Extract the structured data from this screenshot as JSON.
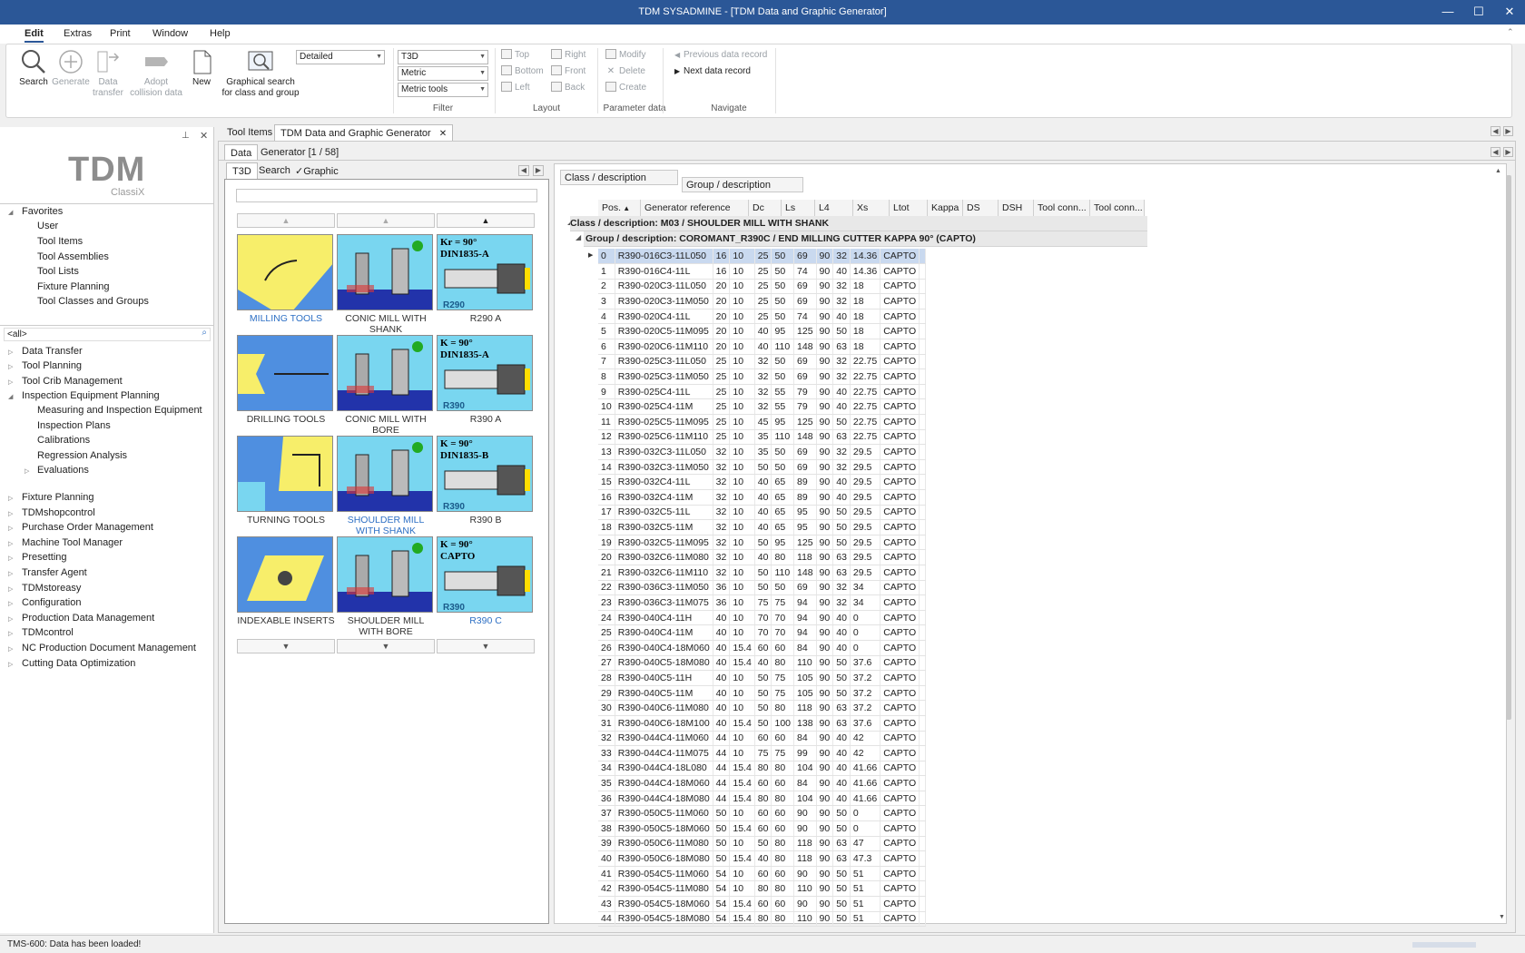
{
  "window": {
    "title": "TDM SYSADMINE - [TDM Data and Graphic Generator]",
    "minimize": "—",
    "maximize": "☐",
    "close": "✕"
  },
  "menu": {
    "items": [
      "Edit",
      "Extras",
      "Print",
      "Window",
      "Help"
    ]
  },
  "ribbon": {
    "search": "Search",
    "generate": "Generate",
    "data_transfer_1": "Data",
    "data_transfer_2": "transfer",
    "adopt_1": "Adopt",
    "adopt_2": "collision data",
    "new": "New",
    "graph_search_1": "Graphical search",
    "graph_search_2": "for class and group",
    "filter": {
      "combo_view": "Detailed",
      "combo_type": "T3D",
      "combo_unit": "Metric",
      "combo_tools": "Metric tools",
      "label": "Filter"
    },
    "layout": {
      "top": "Top",
      "right": "Right",
      "bottom": "Bottom",
      "front": "Front",
      "left": "Left",
      "back": "Back",
      "label": "Layout"
    },
    "parameter": {
      "modify": "Modify",
      "delete": "Delete",
      "create": "Create",
      "label": "Parameter data"
    },
    "navigate": {
      "prev": "Previous data record",
      "next": "Next data record",
      "label": "Navigate"
    }
  },
  "left_panel": {
    "logo_main": "TDM",
    "logo_sub": "ClassiX",
    "favorites_label": "Favorites",
    "favorites": [
      "User",
      "Tool Items",
      "Tool Assemblies",
      "Tool Lists",
      "Fixture Planning",
      "Tool Classes and Groups"
    ],
    "filter_value": "<all>",
    "modules": [
      "Data Transfer",
      "Tool Planning",
      "Tool Crib Management",
      "Inspection Equipment Planning"
    ],
    "inspection_children": [
      "Measuring and Inspection Equipment",
      "Inspection Plans",
      "Calibrations",
      "Regression Analysis",
      "Evaluations"
    ],
    "modules_after": [
      "Fixture Planning",
      "TDMshopcontrol",
      "Purchase Order Management",
      "Machine Tool Manager",
      "Presetting",
      "Transfer Agent",
      "TDMstoreasy",
      "Configuration",
      "Production Data Management",
      "TDMcontrol",
      "NC Production Document Management",
      "Cutting Data Optimization"
    ]
  },
  "tabs": {
    "tool_items": "Tool Items",
    "generator": "TDM Data and Graphic Generator",
    "close": "✕"
  },
  "subtabs": {
    "data": "Data",
    "generator": "Generator [1 / 58]"
  },
  "gallery_tabs": {
    "t3d": "T3D",
    "search": "Search",
    "graphic": "Graphic"
  },
  "gallery": {
    "tiles": [
      {
        "caption": "MILLING TOOLS",
        "link": true
      },
      {
        "caption": "CONIC MILL WITH SHANK",
        "link": false
      },
      {
        "caption": "R290 A",
        "link": false,
        "badge": "Kr = 90°",
        "std": "DIN1835-A",
        "code": "R290"
      },
      {
        "caption": "DRILLING TOOLS",
        "link": false
      },
      {
        "caption": "CONIC MILL WITH BORE",
        "link": false
      },
      {
        "caption": "R390 A",
        "link": false,
        "badge": "K = 90°",
        "std": "DIN1835-A",
        "code": "R390"
      },
      {
        "caption": "TURNING TOOLS",
        "link": false
      },
      {
        "caption": "SHOULDER MILL WITH SHANK",
        "link": true
      },
      {
        "caption": "R390 B",
        "link": false,
        "badge": "K = 90°",
        "std": "DIN1835-B",
        "code": "R390"
      },
      {
        "caption": "INDEXABLE INSERTS",
        "link": false
      },
      {
        "caption": "SHOULDER MILL WITH BORE",
        "link": false
      },
      {
        "caption": "R390 C",
        "link": true,
        "badge": "K = 90°",
        "std": "CAPTO",
        "code": "R390"
      }
    ]
  },
  "filters": {
    "class": "Class / description",
    "group": "Group / description"
  },
  "table": {
    "headers": [
      "Pos.",
      "Generator reference",
      "Dc",
      "Ls",
      "L4",
      "Xs",
      "Ltot",
      "Kappa",
      "DS",
      "DSH",
      "Tool conn...",
      "Tool conn..."
    ],
    "class_row": "Class / description: M03  /  SHOULDER MILL WITH SHANK",
    "group_row": "Group / description: COROMANT_R390C  /  END MILLING CUTTER KAPPA 90° (CAPTO)",
    "rows": [
      [
        "0",
        "R390-016C3-11L050",
        "16",
        "10",
        "25",
        "50",
        "69",
        "90",
        "32",
        "14.36",
        "CAPTO"
      ],
      [
        "1",
        "R390-016C4-11L",
        "16",
        "10",
        "25",
        "50",
        "74",
        "90",
        "40",
        "14.36",
        "CAPTO"
      ],
      [
        "2",
        "R390-020C3-11L050",
        "20",
        "10",
        "25",
        "50",
        "69",
        "90",
        "32",
        "18",
        "CAPTO"
      ],
      [
        "3",
        "R390-020C3-11M050",
        "20",
        "10",
        "25",
        "50",
        "69",
        "90",
        "32",
        "18",
        "CAPTO"
      ],
      [
        "4",
        "R390-020C4-11L",
        "20",
        "10",
        "25",
        "50",
        "74",
        "90",
        "40",
        "18",
        "CAPTO"
      ],
      [
        "5",
        "R390-020C5-11M095",
        "20",
        "10",
        "40",
        "95",
        "125",
        "90",
        "50",
        "18",
        "CAPTO"
      ],
      [
        "6",
        "R390-020C6-11M110",
        "20",
        "10",
        "40",
        "110",
        "148",
        "90",
        "63",
        "18",
        "CAPTO"
      ],
      [
        "7",
        "R390-025C3-11L050",
        "25",
        "10",
        "32",
        "50",
        "69",
        "90",
        "32",
        "22.75",
        "CAPTO"
      ],
      [
        "8",
        "R390-025C3-11M050",
        "25",
        "10",
        "32",
        "50",
        "69",
        "90",
        "32",
        "22.75",
        "CAPTO"
      ],
      [
        "9",
        "R390-025C4-11L",
        "25",
        "10",
        "32",
        "55",
        "79",
        "90",
        "40",
        "22.75",
        "CAPTO"
      ],
      [
        "10",
        "R390-025C4-11M",
        "25",
        "10",
        "32",
        "55",
        "79",
        "90",
        "40",
        "22.75",
        "CAPTO"
      ],
      [
        "11",
        "R390-025C5-11M095",
        "25",
        "10",
        "45",
        "95",
        "125",
        "90",
        "50",
        "22.75",
        "CAPTO"
      ],
      [
        "12",
        "R390-025C6-11M110",
        "25",
        "10",
        "35",
        "110",
        "148",
        "90",
        "63",
        "22.75",
        "CAPTO"
      ],
      [
        "13",
        "R390-032C3-11L050",
        "32",
        "10",
        "35",
        "50",
        "69",
        "90",
        "32",
        "29.5",
        "CAPTO"
      ],
      [
        "14",
        "R390-032C3-11M050",
        "32",
        "10",
        "50",
        "50",
        "69",
        "90",
        "32",
        "29.5",
        "CAPTO"
      ],
      [
        "15",
        "R390-032C4-11L",
        "32",
        "10",
        "40",
        "65",
        "89",
        "90",
        "40",
        "29.5",
        "CAPTO"
      ],
      [
        "16",
        "R390-032C4-11M",
        "32",
        "10",
        "40",
        "65",
        "89",
        "90",
        "40",
        "29.5",
        "CAPTO"
      ],
      [
        "17",
        "R390-032C5-11L",
        "32",
        "10",
        "40",
        "65",
        "95",
        "90",
        "50",
        "29.5",
        "CAPTO"
      ],
      [
        "18",
        "R390-032C5-11M",
        "32",
        "10",
        "40",
        "65",
        "95",
        "90",
        "50",
        "29.5",
        "CAPTO"
      ],
      [
        "19",
        "R390-032C5-11M095",
        "32",
        "10",
        "50",
        "95",
        "125",
        "90",
        "50",
        "29.5",
        "CAPTO"
      ],
      [
        "20",
        "R390-032C6-11M080",
        "32",
        "10",
        "40",
        "80",
        "118",
        "90",
        "63",
        "29.5",
        "CAPTO"
      ],
      [
        "21",
        "R390-032C6-11M110",
        "32",
        "10",
        "50",
        "110",
        "148",
        "90",
        "63",
        "29.5",
        "CAPTO"
      ],
      [
        "22",
        "R390-036C3-11M050",
        "36",
        "10",
        "50",
        "50",
        "69",
        "90",
        "32",
        "34",
        "CAPTO"
      ],
      [
        "23",
        "R390-036C3-11M075",
        "36",
        "10",
        "75",
        "75",
        "94",
        "90",
        "32",
        "34",
        "CAPTO"
      ],
      [
        "24",
        "R390-040C4-11H",
        "40",
        "10",
        "70",
        "70",
        "94",
        "90",
        "40",
        "0",
        "CAPTO"
      ],
      [
        "25",
        "R390-040C4-11M",
        "40",
        "10",
        "70",
        "70",
        "94",
        "90",
        "40",
        "0",
        "CAPTO"
      ],
      [
        "26",
        "R390-040C4-18M060",
        "40",
        "15.4",
        "60",
        "60",
        "84",
        "90",
        "40",
        "0",
        "CAPTO"
      ],
      [
        "27",
        "R390-040C5-18M080",
        "40",
        "15.4",
        "40",
        "80",
        "110",
        "90",
        "50",
        "37.6",
        "CAPTO"
      ],
      [
        "28",
        "R390-040C5-11H",
        "40",
        "10",
        "50",
        "75",
        "105",
        "90",
        "50",
        "37.2",
        "CAPTO"
      ],
      [
        "29",
        "R390-040C5-11M",
        "40",
        "10",
        "50",
        "75",
        "105",
        "90",
        "50",
        "37.2",
        "CAPTO"
      ],
      [
        "30",
        "R390-040C6-11M080",
        "40",
        "10",
        "50",
        "80",
        "118",
        "90",
        "63",
        "37.2",
        "CAPTO"
      ],
      [
        "31",
        "R390-040C6-18M100",
        "40",
        "15.4",
        "50",
        "100",
        "138",
        "90",
        "63",
        "37.6",
        "CAPTO"
      ],
      [
        "32",
        "R390-044C4-11M060",
        "44",
        "10",
        "60",
        "60",
        "84",
        "90",
        "40",
        "42",
        "CAPTO"
      ],
      [
        "33",
        "R390-044C4-11M075",
        "44",
        "10",
        "75",
        "75",
        "99",
        "90",
        "40",
        "42",
        "CAPTO"
      ],
      [
        "34",
        "R390-044C4-18L080",
        "44",
        "15.4",
        "80",
        "80",
        "104",
        "90",
        "40",
        "41.66",
        "CAPTO"
      ],
      [
        "35",
        "R390-044C4-18M060",
        "44",
        "15.4",
        "60",
        "60",
        "84",
        "90",
        "40",
        "41.66",
        "CAPTO"
      ],
      [
        "36",
        "R390-044C4-18M080",
        "44",
        "15.4",
        "80",
        "80",
        "104",
        "90",
        "40",
        "41.66",
        "CAPTO"
      ],
      [
        "37",
        "R390-050C5-11M060",
        "50",
        "10",
        "60",
        "60",
        "90",
        "90",
        "50",
        "0",
        "CAPTO"
      ],
      [
        "38",
        "R390-050C5-18M060",
        "50",
        "15.4",
        "60",
        "60",
        "90",
        "90",
        "50",
        "0",
        "CAPTO"
      ],
      [
        "39",
        "R390-050C6-11M080",
        "50",
        "10",
        "50",
        "80",
        "118",
        "90",
        "63",
        "47",
        "CAPTO"
      ],
      [
        "40",
        "R390-050C6-18M080",
        "50",
        "15.4",
        "40",
        "80",
        "118",
        "90",
        "63",
        "47.3",
        "CAPTO"
      ],
      [
        "41",
        "R390-054C5-11M060",
        "54",
        "10",
        "60",
        "60",
        "90",
        "90",
        "50",
        "51",
        "CAPTO"
      ],
      [
        "42",
        "R390-054C5-11M080",
        "54",
        "10",
        "80",
        "80",
        "110",
        "90",
        "50",
        "51",
        "CAPTO"
      ],
      [
        "43",
        "R390-054C5-18M060",
        "54",
        "15.4",
        "60",
        "60",
        "90",
        "90",
        "50",
        "51",
        "CAPTO"
      ],
      [
        "44",
        "R390-054C5-18M080",
        "54",
        "15.4",
        "80",
        "80",
        "110",
        "90",
        "50",
        "51",
        "CAPTO"
      ]
    ]
  },
  "status": {
    "message": "TMS-600: Data has been loaded!"
  },
  "colors": {
    "titlebar": "#2b5797",
    "accent_link": "#2d6fc4",
    "selection": "#c9d9ef",
    "tile_bg": "#79d6f0",
    "tile_yellow": "#f7ee6a",
    "tile_blue": "#4f8fe0"
  }
}
